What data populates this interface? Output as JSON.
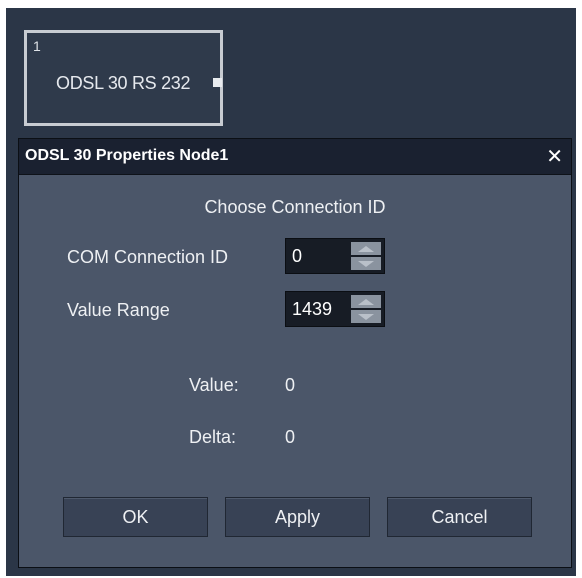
{
  "node": {
    "index": "1",
    "label": "ODSL 30 RS 232"
  },
  "dialog": {
    "title": "ODSL 30 Properties Node1",
    "close_glyph": "✕",
    "heading": "Choose Connection ID",
    "fields": {
      "com_connection_id": {
        "label": "COM Connection ID",
        "value": "0"
      },
      "value_range": {
        "label": "Value Range",
        "value": "1439"
      }
    },
    "readouts": {
      "value": {
        "label": "Value:",
        "value": "0"
      },
      "delta": {
        "label": "Delta:",
        "value": "0"
      }
    },
    "buttons": {
      "ok": "OK",
      "apply": "Apply",
      "cancel": "Cancel"
    }
  },
  "colors": {
    "canvas_bg": "#2b3647",
    "dialog_titlebar": "#1a2130",
    "dialog_body": "#4b5669",
    "spinbox_bg": "#171c25",
    "button_bg": "#384255"
  },
  "icons": {
    "close": "close-icon",
    "spin_up": "triangle-up-icon",
    "spin_down": "triangle-down-icon",
    "output_port": "output-port-icon"
  }
}
